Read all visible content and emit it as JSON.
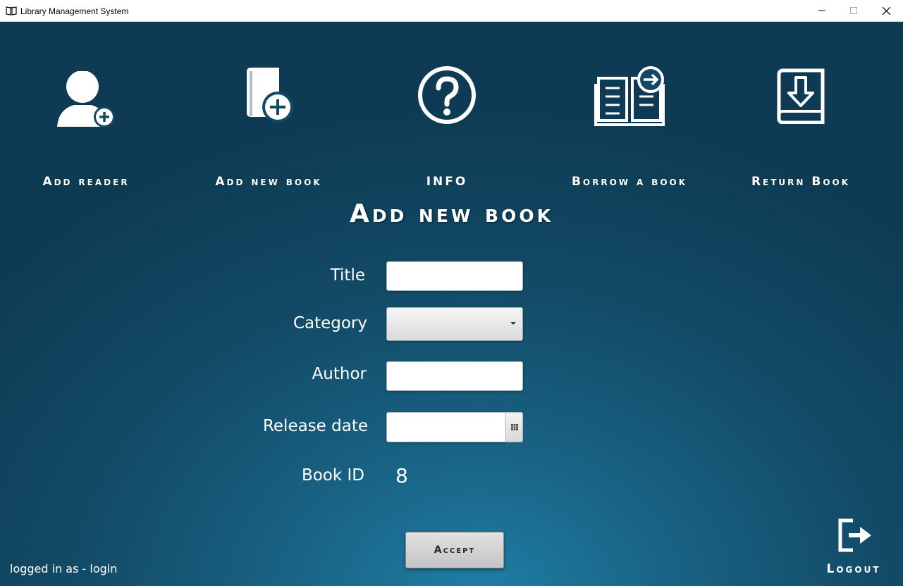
{
  "window": {
    "title": "Library Management System",
    "icons": {
      "app": "open-book-icon",
      "minimize": "minimize-icon",
      "maximize": "maximize-icon",
      "close": "close-icon"
    }
  },
  "toolbar": {
    "items": [
      {
        "label": "Add reader",
        "icon": "user-add-icon"
      },
      {
        "label": "Add new book",
        "icon": "book-add-icon"
      },
      {
        "label": "INFO",
        "icon": "question-icon"
      },
      {
        "label": "Borrow a book",
        "icon": "open-book-arrow-icon"
      },
      {
        "label": "Return Book",
        "icon": "book-return-icon"
      }
    ]
  },
  "page": {
    "heading": "Add new book"
  },
  "form": {
    "title_label": "Title",
    "title_value": "",
    "category_label": "Category",
    "category_value": "",
    "author_label": "Author",
    "author_value": "",
    "release_date_label": "Release date",
    "release_date_value": "",
    "book_id_label": "Book ID",
    "book_id_value": "8"
  },
  "actions": {
    "accept_label": "Accept",
    "logout_label": "Logout"
  },
  "status": {
    "logged_in_text": "logged in as - login"
  },
  "colors": {
    "background": "#124a66",
    "accent": "#1f7ea6",
    "text": "#ffffff"
  }
}
